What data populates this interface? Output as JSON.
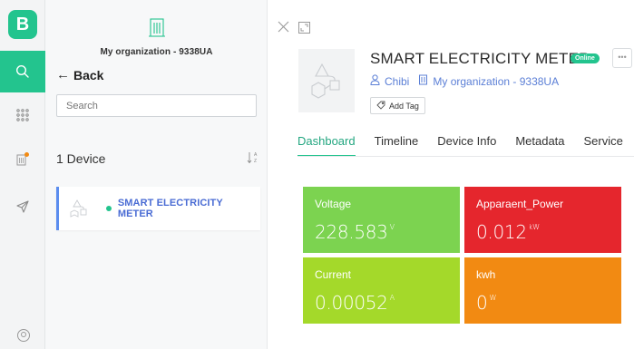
{
  "app": {
    "logo_letter": "B"
  },
  "rail": {
    "items": [
      {
        "icon": "search-icon",
        "active": true
      },
      {
        "icon": "apps-grid-icon",
        "active": false
      },
      {
        "icon": "building-notification-icon",
        "active": false
      },
      {
        "icon": "send-icon",
        "active": false
      }
    ],
    "bottom_icon": "user-avatar-icon"
  },
  "list": {
    "org_name": "My organization - 9338UA",
    "back_label": "Back",
    "search_placeholder": "Search",
    "device_count": "1 Device",
    "sort_icon": "sort-az-icon",
    "devices": [
      {
        "name": "SMART ELECTRICITY METER",
        "status_color": "#23c48e"
      }
    ]
  },
  "device": {
    "title": "SMART ELECTRICITY METER",
    "status_badge": "Online",
    "owner": "Chibi",
    "organization": "My organization - 9338UA",
    "add_tag_label": "Add Tag",
    "more_label": "•••"
  },
  "tabs": [
    {
      "label": "Dashboard",
      "active": true
    },
    {
      "label": "Timeline",
      "active": false
    },
    {
      "label": "Device Info",
      "active": false
    },
    {
      "label": "Metadata",
      "active": false
    },
    {
      "label": "Service",
      "active": false
    }
  ],
  "widgets": [
    {
      "title": "Voltage",
      "value": "228.583",
      "unit": "V",
      "color": "#7cd350"
    },
    {
      "title": "Apparaent_Power",
      "value": "0.012",
      "unit": "kW",
      "color": "#e5262d"
    },
    {
      "title": "Current",
      "value": "0.00052",
      "unit": "A",
      "color": "#a4d92a"
    },
    {
      "title": "kwh",
      "value": "0",
      "unit": "W",
      "color": "#f28a12"
    }
  ],
  "colors": {
    "brand": "#23c48e",
    "link": "#5b7fd6",
    "selected_border": "#5b8def"
  }
}
